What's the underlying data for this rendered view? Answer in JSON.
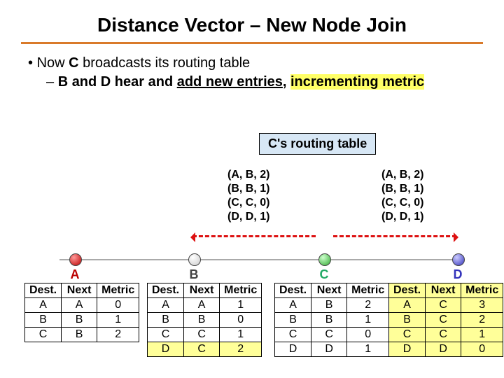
{
  "title": "Distance Vector – New Node Join",
  "bullets": {
    "l1_pre": "Now ",
    "l1_bold": "C",
    "l1_post": " broadcasts its routing table",
    "l2_plain": "B and D hear and ",
    "l2_under": "add new entries",
    "l2_comma": ", ",
    "l2_hl": "incrementing metric"
  },
  "caption": "C's routing table",
  "tuples": {
    "r0": "(A, B, 2)",
    "r1": "(B, B, 1)",
    "r2": "(C, C, 0)",
    "r3": "(D, D, 1)"
  },
  "nodes": {
    "a": "A",
    "b": "B",
    "c": "C",
    "d": "D"
  },
  "headers": {
    "dest": "Dest.",
    "next": "Next",
    "metric": "Metric"
  },
  "tables": {
    "A": [
      {
        "dest": "A",
        "next": "A",
        "metric": "0"
      },
      {
        "dest": "B",
        "next": "B",
        "metric": "1"
      },
      {
        "dest": "C",
        "next": "B",
        "metric": "2"
      }
    ],
    "B": [
      {
        "dest": "A",
        "next": "A",
        "metric": "1"
      },
      {
        "dest": "B",
        "next": "B",
        "metric": "0"
      },
      {
        "dest": "C",
        "next": "C",
        "metric": "1"
      },
      {
        "dest": "D",
        "next": "C",
        "metric": "2"
      }
    ],
    "C": [
      {
        "dest": "A",
        "next": "B",
        "metric": "2"
      },
      {
        "dest": "B",
        "next": "B",
        "metric": "1"
      },
      {
        "dest": "C",
        "next": "C",
        "metric": "0"
      },
      {
        "dest": "D",
        "next": "D",
        "metric": "1"
      }
    ],
    "D": [
      {
        "dest": "A",
        "next": "C",
        "metric": "3"
      },
      {
        "dest": "B",
        "next": "C",
        "metric": "2"
      },
      {
        "dest": "C",
        "next": "C",
        "metric": "1"
      },
      {
        "dest": "D",
        "next": "D",
        "metric": "0"
      }
    ]
  }
}
